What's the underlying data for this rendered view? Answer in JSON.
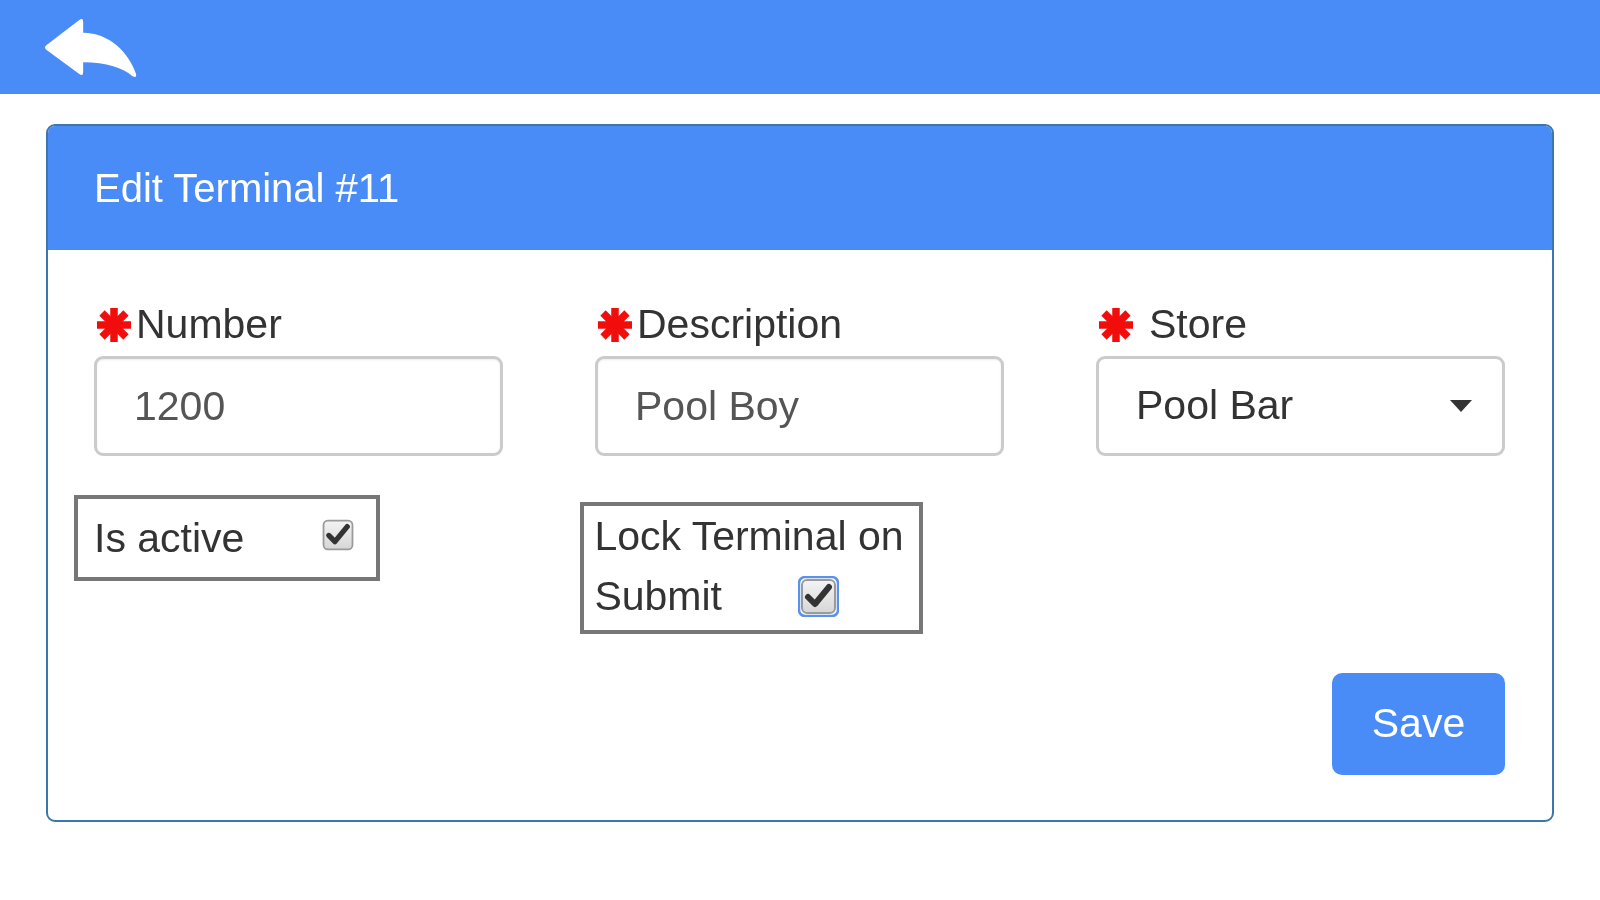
{
  "form": {
    "title": "Edit Terminal #11",
    "fields": [
      {
        "kind": "text",
        "label": "Number",
        "required": true,
        "value": "1200"
      },
      {
        "kind": "text",
        "label": "Description",
        "required": true,
        "value": "Pool Boy"
      },
      {
        "kind": "select",
        "label": "Store",
        "required": true,
        "value": "Pool Bar"
      }
    ],
    "options": [
      {
        "label_lines": [
          "Is active"
        ],
        "checked": true,
        "focused": false
      },
      {
        "label_lines": [
          "Lock Terminal on",
          "Submit"
        ],
        "checked": true,
        "focused": true
      }
    ],
    "buttons": [
      "Save"
    ]
  }
}
